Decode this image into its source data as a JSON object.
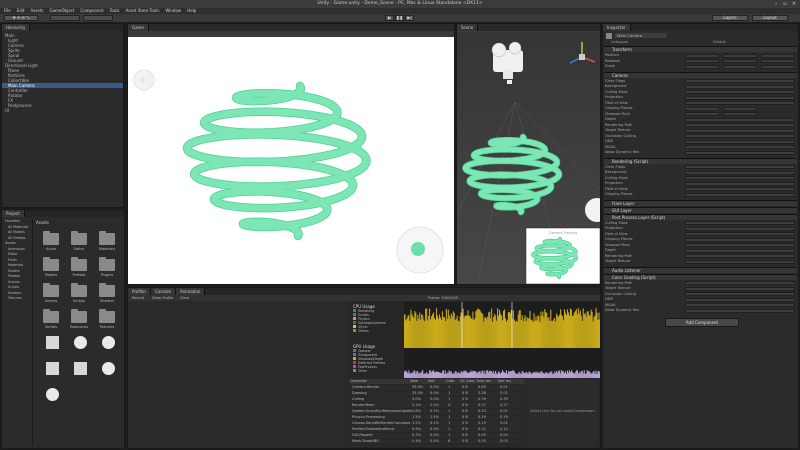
{
  "window": {
    "title": "Unity - Game.unity - Demo_Scene - PC, Mac & Linux Standalone <DX11>"
  },
  "menu": [
    "File",
    "Edit",
    "Assets",
    "GameObject",
    "Component",
    "Tools",
    "Asset Store Tools",
    "Window",
    "Help"
  ],
  "toolbar": {
    "play": "▶",
    "pause": "❚❚",
    "step": "▶|",
    "layers": "Layers",
    "layout": "Layout"
  },
  "hierarchy": {
    "tab": "Hierarchy",
    "items": [
      "Main",
      "Light",
      "Camera",
      "Sprite",
      "Spiral",
      "Ground",
      "Directional Light",
      "Plane",
      "Particles",
      "Collectible",
      "Main Camera",
      "Controller",
      "Rotator",
      "FX",
      "Postprocess",
      "UI"
    ]
  },
  "project": {
    "tab": "Project",
    "search": "Search",
    "breadcrumb": "Assets",
    "tree": [
      "Favorites",
      "All Materials",
      "All Models",
      "All Prefabs",
      "Assets",
      "Animation",
      "Editor",
      "Fonts",
      "Materials",
      "Models",
      "Prefabs",
      "Scenes",
      "Scripts",
      "Shaders",
      "Textures"
    ],
    "folders": [
      "Audio",
      "Editor",
      "Materials",
      "Models",
      "Prefabs",
      "Plugins",
      "Scenes",
      "Scripts",
      "Shaders",
      "Sprites",
      "Resources",
      "Textures"
    ]
  },
  "scene": {
    "tab": "Scene",
    "shaded": "Shaded",
    "twoD": "2D",
    "gizmos": "Gizmos",
    "persp": "Persp"
  },
  "game": {
    "tab": "Game",
    "camera_preview": "Camera Preview"
  },
  "profiler": {
    "tab": "Profiler",
    "tabs": [
      "Profiler",
      "Console",
      "Animation"
    ],
    "record": "Record",
    "deep": "Deep Profile",
    "clear": "Clear",
    "frame": "Frame: 100/1045",
    "cpu_label": "CPU Usage",
    "gpu_label": "GPU Usage",
    "cpu_legend": [
      "Rendering",
      "Scripts",
      "Physics",
      "GarbageCollector",
      "VSync",
      "Others"
    ],
    "gpu_legend": [
      "Opaque",
      "Transparent",
      "Shadows/Depth",
      "Deferred PrePass",
      "PostProcess",
      "Other"
    ],
    "columns": [
      "Overview",
      "Total",
      "Self",
      "Calls",
      "GC Alloc",
      "Time ms",
      "Self ms"
    ],
    "rows": [
      [
        "Camera.Render",
        "35.9%",
        "0.0%",
        "1",
        "0 B",
        "4.65",
        "0.01"
      ],
      [
        "Drawing",
        "25.4%",
        "0.0%",
        "1",
        "0 B",
        "3.28",
        "0.01"
      ],
      [
        "Culling",
        "3.0%",
        "3.0%",
        "1",
        "0 B",
        "0.39",
        "0.39"
      ],
      [
        "Render.Mesh",
        "2.1%",
        "2.1%",
        "4",
        "0 B",
        "0.27",
        "0.27"
      ],
      [
        "Update.ScriptRunBehaviourUpdate",
        "1.8%",
        "0.1%",
        "1",
        "0 B",
        "0.23",
        "0.01"
      ],
      [
        "Physics.Processing",
        "1.5%",
        "1.5%",
        "1",
        "0 B",
        "0.19",
        "0.19"
      ],
      [
        "Canvas.SendWillRenderCanvases",
        "1.2%",
        "0.1%",
        "1",
        "0 B",
        "0.15",
        "0.01"
      ],
      [
        "Profiler.FinalizeAndSend",
        "0.9%",
        "0.9%",
        "1",
        "0 B",
        "0.12",
        "0.12"
      ],
      [
        "GUI.Repaint",
        "0.7%",
        "0.0%",
        "1",
        "0 B",
        "0.09",
        "0.00"
      ],
      [
        "Mesh.DrawVBO",
        "0.4%",
        "0.4%",
        "8",
        "0 B",
        "0.05",
        "0.05"
      ]
    ],
    "details": "Select Line for per-object breakdown"
  },
  "inspector": {
    "tab": "Inspector",
    "object": "Main Camera",
    "tag": "Untagged",
    "layer": "Default",
    "transform": "Transform",
    "camera": "Camera",
    "rendering": "Rendering (Script)",
    "flare": "Flare Layer",
    "gui": "GUI Layer",
    "listener": "Audio Listener",
    "fx1": "Post Process Layer (Script)",
    "fx2": "Color Grading (Script)",
    "add": "Add Component",
    "labels": [
      "Position",
      "Rotation",
      "Scale",
      "Clear Flags",
      "Background",
      "Culling Mask",
      "Projection",
      "Field of View",
      "Clipping Planes",
      "Viewport Rect",
      "Depth",
      "Rendering Path",
      "Target Texture",
      "Occlusion Culling",
      "HDR",
      "MSAA",
      "Allow Dynamic Res"
    ]
  },
  "colors": {
    "spring": "#7ce6b4",
    "spring_dark": "#4fcf94",
    "cpu": "#c8aa1a",
    "gpu": "#b8a3d8",
    "accent": "#3a5a8c"
  }
}
